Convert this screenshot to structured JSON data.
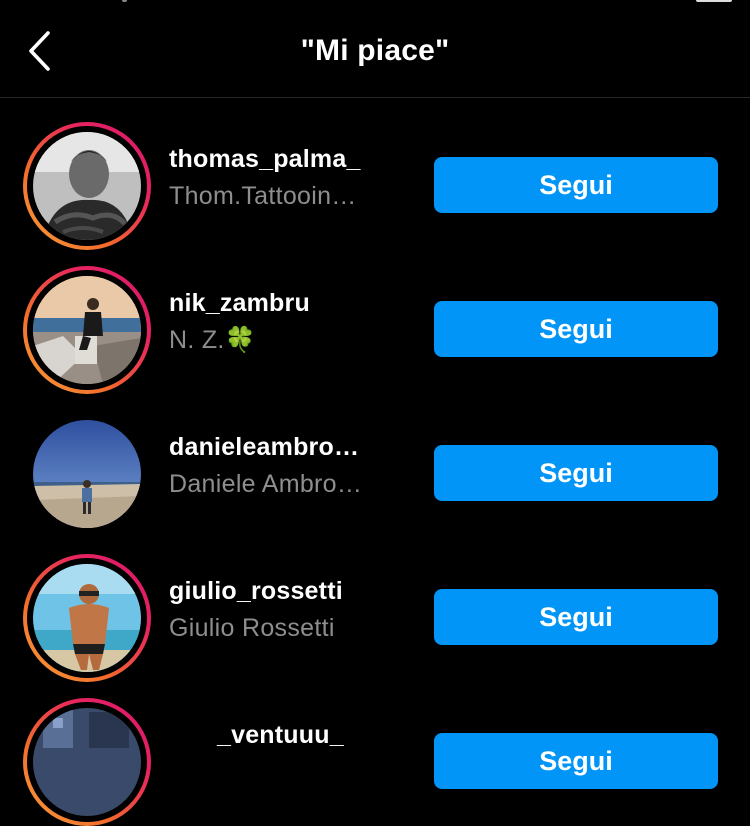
{
  "header": {
    "title": "\"Mi piace\"",
    "back_icon": "chevron-left-icon"
  },
  "colors": {
    "background": "#000000",
    "follow_button": "#0095f6",
    "secondary_text": "#8e8e8e",
    "story_ring": [
      "#f9a43a",
      "#e8245f"
    ]
  },
  "users": [
    {
      "username": "thomas_palma_",
      "full_name": "Thom.Tattooin…",
      "button": "Segui",
      "story_ring": true
    },
    {
      "username": "nik_zambru",
      "full_name": "N. Z.🍀",
      "button": "Segui",
      "story_ring": true
    },
    {
      "username": "danieleambro…",
      "full_name": "Daniele Ambro…",
      "button": "Segui",
      "story_ring": false
    },
    {
      "username": "giulio_rossetti",
      "full_name": "Giulio Rossetti",
      "button": "Segui",
      "story_ring": true
    },
    {
      "username": "_ventuuu_",
      "full_name": "",
      "button": "Segui",
      "story_ring": true
    }
  ]
}
